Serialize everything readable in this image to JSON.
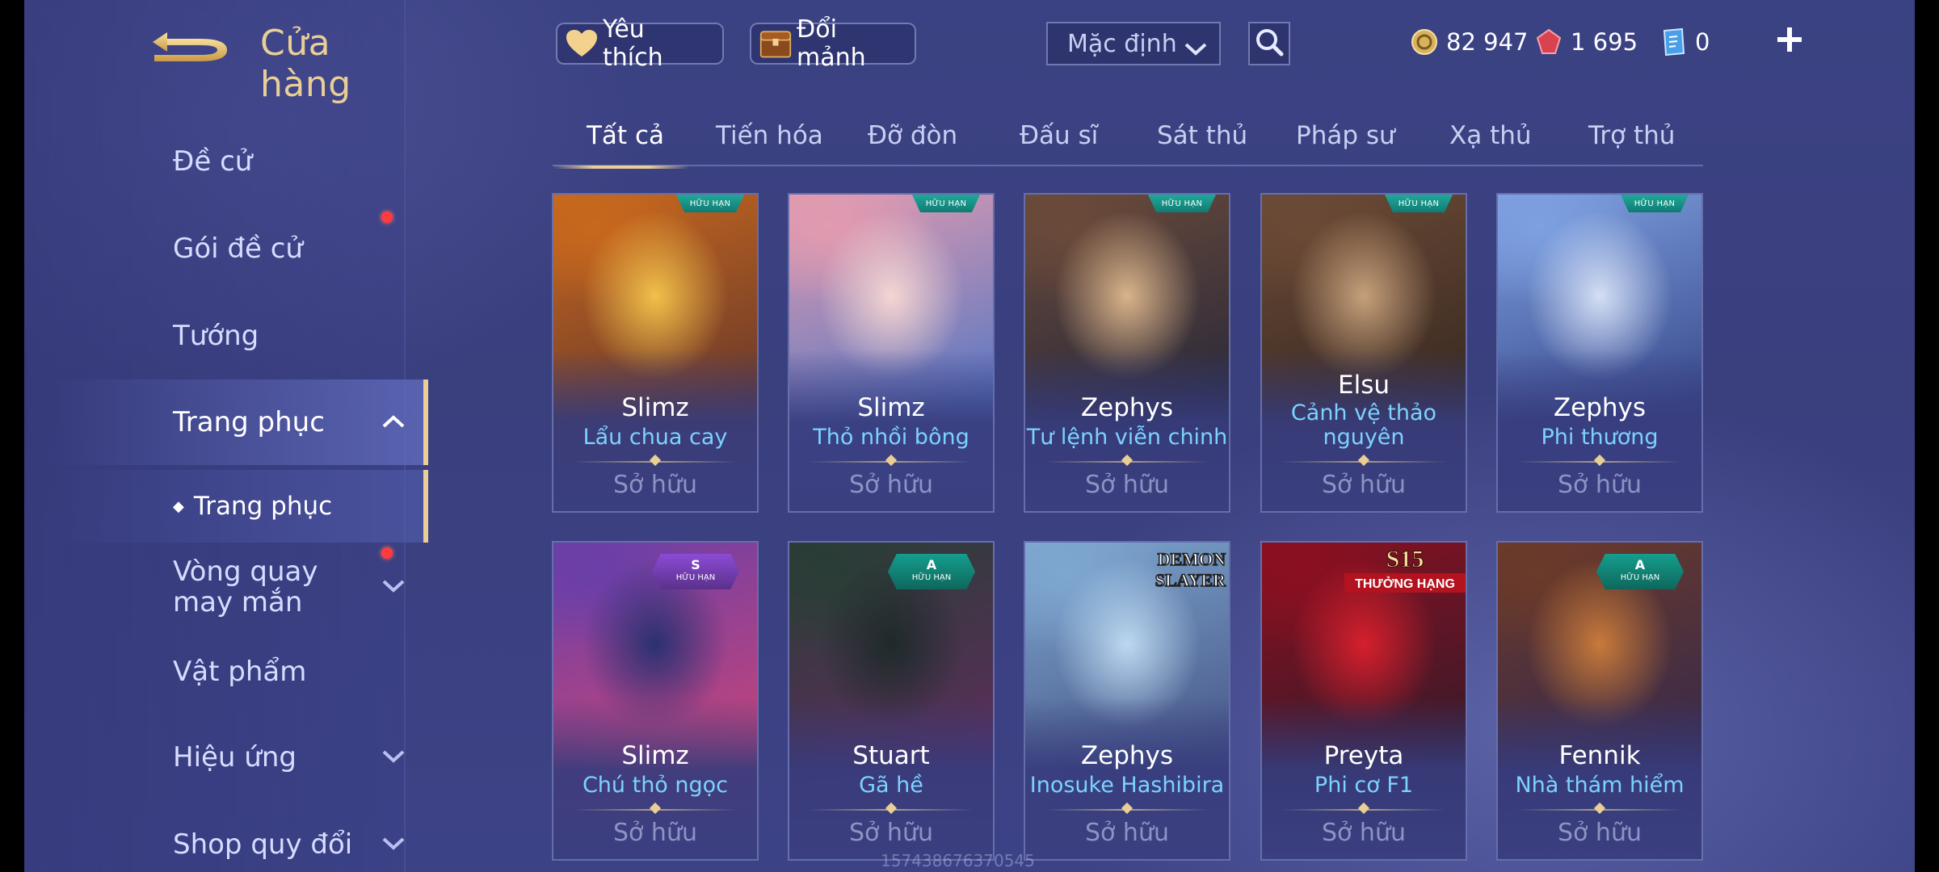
{
  "header": {
    "title": "Cửa hàng",
    "favorites_label": "Yêu thích",
    "exchange_label": "Đổi mảnh",
    "sort_value": "Mặc định",
    "currencies": [
      {
        "icon": "gold-coin-icon",
        "value": "82 947"
      },
      {
        "icon": "red-gem-icon",
        "value": "1 695"
      },
      {
        "icon": "blue-voucher-icon",
        "value": "0"
      }
    ]
  },
  "sidebar": {
    "items": [
      {
        "label": "Đề cử"
      },
      {
        "label": "Gói đề cử",
        "notify": true
      },
      {
        "label": "Tướng"
      },
      {
        "label": "Trang phục",
        "active": true,
        "expanded": true
      },
      {
        "label": "Trang phục",
        "sub": true
      },
      {
        "label": "Vòng quay may mắn",
        "notify": true,
        "collapsible": true
      },
      {
        "label": "Vật phẩm"
      },
      {
        "label": "Hiệu ứng",
        "collapsible": true
      },
      {
        "label": "Shop quy đổi",
        "collapsible": true
      }
    ]
  },
  "tabs": [
    "Tất cả",
    "Tiến hóa",
    "Đỡ đòn",
    "Đấu sĩ",
    "Sát thủ",
    "Pháp sư",
    "Xạ thủ",
    "Trợ thủ"
  ],
  "active_tab": "Tất cả",
  "owned_label": "Sở hữu",
  "cards": [
    {
      "hero": "Slimz",
      "skin": "Lẩu chua cay",
      "badge": "HỮU HẠN",
      "art": [
        "#f2c04a",
        "#c8681e",
        "#6b3a2a"
      ]
    },
    {
      "hero": "Slimz",
      "skin": "Thỏ nhồi bông",
      "badge": "HỮU HẠN",
      "art": [
        "#f4d6d2",
        "#e29bb0",
        "#5c78c2"
      ]
    },
    {
      "hero": "Zephys",
      "skin": "Tư lệnh viễn chinh",
      "badge": "HỮU HẠN",
      "art": [
        "#d9b48a",
        "#6a4a3a",
        "#2b2a3a"
      ]
    },
    {
      "hero": "Elsu",
      "skin": "Cảnh vệ thảo nguyên",
      "badge": "HỮU HẠN",
      "art": [
        "#c6a07a",
        "#6b4a36",
        "#3a2a22"
      ]
    },
    {
      "hero": "Zephys",
      "skin": "Phi thương",
      "badge": "HỮU HẠN",
      "art": [
        "#d4dff5",
        "#7ea0e0",
        "#3b4d8f"
      ]
    },
    {
      "hero": "Slimz",
      "skin": "Chú thỏ ngọc",
      "badge_grade": "S",
      "badge_sub": "HỮU HẠN",
      "badge_color": "#8c4bd6",
      "art": [
        "#2a3170",
        "#6a3fa8",
        "#c2447a"
      ]
    },
    {
      "hero": "Stuart",
      "skin": "Gã hề",
      "badge_grade": "A",
      "badge_sub": "HỮU HẠN",
      "badge_color": "#159e8e",
      "art": [
        "#1e2a2a",
        "#2a3d36",
        "#5a2e5a"
      ]
    },
    {
      "hero": "Zephys",
      "skin": "Inosuke Hashibira",
      "tag": "DEMON SLAYER",
      "art": [
        "#bcd8f0",
        "#7ea7d0",
        "#4a5a8a"
      ]
    },
    {
      "hero": "Preyta",
      "skin": "Phi cơ F1",
      "tag": "S15 THƯỞNG HẠNG",
      "art": [
        "#d61f2c",
        "#8a1020",
        "#3a1a2a"
      ]
    },
    {
      "hero": "Fennik",
      "skin": "Nhà thám hiểm",
      "badge_grade": "A",
      "badge_sub": "HỮU HẠN",
      "badge_color": "#159e8e",
      "art": [
        "#c87a3a",
        "#6a3a2a",
        "#3a2a4a"
      ]
    }
  ],
  "watermark": "1574386763705​45"
}
